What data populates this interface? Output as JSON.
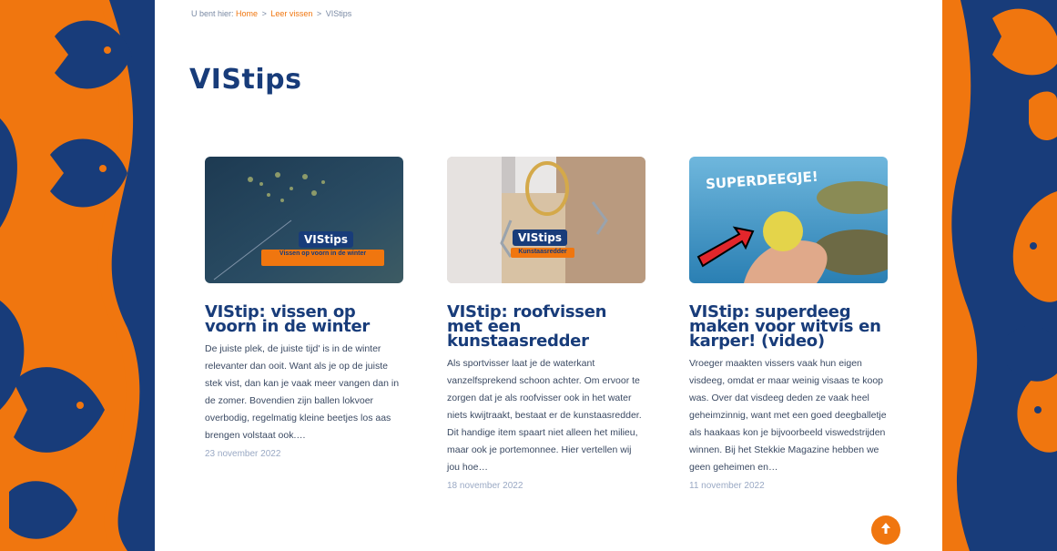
{
  "breadcrumb": {
    "prefix": "U bent hier:",
    "items": [
      "Home",
      "Leer vissen"
    ],
    "current": "VIStips",
    "separator": ">"
  },
  "page": {
    "title": "VIStips"
  },
  "colors": {
    "navy": "#183c7a",
    "orange": "#f0760f"
  },
  "cards": [
    {
      "thumb_badge": "VIStips",
      "thumb_caption": "Vissen op voorn in de winter",
      "title": "VIStip: vissen op voorn in de winter",
      "excerpt": "De juiste plek, de juiste tijd' is in de winter relevanter dan ooit. Want als je op de juiste stek vist, dan kan je vaak meer vangen dan in de zomer. Bovendien zijn ballen lokvoer overbodig, regelmatig kleine beetjes los aas brengen volstaat ook.…",
      "date": "23 november 2022"
    },
    {
      "thumb_badge": "VIStips",
      "thumb_caption": "Kunstaasredder",
      "title": "VIStip: roofvissen met een kunstaasredder",
      "excerpt": "Als sportvisser laat je de waterkant vanzelfsprekend schoon achter. Om ervoor te zorgen dat je als roofvisser ook in het water niets kwijtraakt, bestaat er de kunstaasredder. Dit handige item spaart niet alleen het milieu, maar ook je portemonnee. Hier vertellen wij jou hoe…",
      "date": "18 november 2022"
    },
    {
      "thumb_badge": "SUPERDEEGJE!",
      "title": "VIStip: superdeeg maken voor witvis en karper! (video)",
      "excerpt": "Vroeger maakten vissers vaak hun eigen visdeeg, omdat er maar weinig visaas te koop was. Over dat visdeeg deden ze vaak heel geheimzinnig, want met een goed deegballetje als haakaas kon je bijvoorbeeld viswedstrijden winnen. Bij het Stekkie Magazine hebben we geen geheimen en…",
      "date": "11 november 2022"
    }
  ],
  "icons": {
    "scroll_top": "arrow-up-icon",
    "side_decoration": "piranha-icon"
  }
}
